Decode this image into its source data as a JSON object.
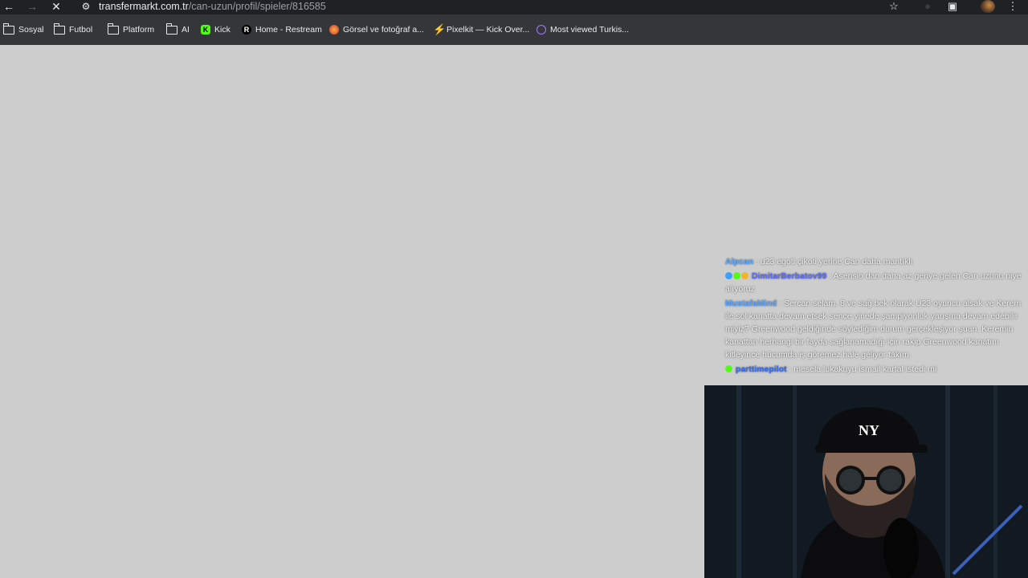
{
  "browser": {
    "url_host": "transfermarkt.com.tr",
    "url_path": "/can-uzun/profil/spieler/816585",
    "icons": {
      "back": "back-arrow-icon",
      "forward": "forward-arrow-icon",
      "stop": "close-icon",
      "site_info": "site-settings-icon",
      "star": "star-icon",
      "extensions": "puzzle-icon",
      "menu": "kebab-menu-icon"
    }
  },
  "bookmarks": [
    {
      "label": "Sosyal",
      "icon": "folder-icon"
    },
    {
      "label": "Futbol",
      "icon": "folder-icon"
    },
    {
      "label": "Platform",
      "icon": "folder-icon"
    },
    {
      "label": "AI",
      "icon": "folder-icon"
    },
    {
      "label": "Kick",
      "icon": "kick-icon"
    },
    {
      "label": "Home - Restream",
      "icon": "restream-icon"
    },
    {
      "label": "Görsel ve fotoğraf a...",
      "icon": "image-site-icon"
    },
    {
      "label": "Pixelkit — Kick Over...",
      "icon": "pixelkit-icon"
    },
    {
      "label": "Most viewed Turkis...",
      "icon": "chart-site-icon"
    }
  ],
  "chat": [
    {
      "user": "Alpcan",
      "user_color": "#5ea7ff",
      "text": "u23 egoti çikoti yerine Can daha mantıklı"
    },
    {
      "user": "DimitarBerbatov99",
      "user_color": "#5b6cff",
      "text": "Asensio dan daha az geriye gelen Can uzunu niye alıyoruz"
    },
    {
      "user": "MustafaMind",
      "user_color": "#5ea7ff",
      "text": "Sercan selam. 8 ve sağ bek olarak U23 oyuncu alsak ve Kerem ile sol kanatta devam etsek sence yinede şampiyonluk yarışına devam edebilir miyiz? Greenwood geldiğinde söylediğim durum gerçekleşiyor şuan. Keremin kanattan herhangi bir fayda sağlanamadığı için rakip Greenwood kanatını kitleyince hücumda iş göremez hale geliyor takım."
    },
    {
      "user": "parttimepilot",
      "user_color": "#2f6bff",
      "text": "mesela lukakuyu ismail kartal istedi mi"
    }
  ],
  "colors": {
    "toolbar_bg": "#202124",
    "bookmarks_bg": "#35363a",
    "page_bg": "#cdcdcd"
  }
}
